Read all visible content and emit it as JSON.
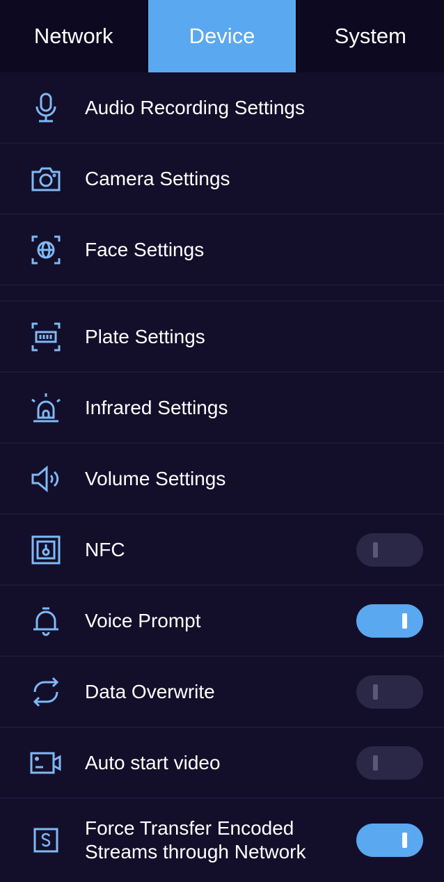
{
  "tabs": [
    {
      "label": "Network",
      "active": false
    },
    {
      "label": "Device",
      "active": true
    },
    {
      "label": "System",
      "active": false
    }
  ],
  "items": [
    {
      "label": "Audio Recording Settings",
      "icon": "microphone-icon"
    },
    {
      "label": "Camera Settings",
      "icon": "camera-icon"
    },
    {
      "label": "Face Settings",
      "icon": "face-scan-icon"
    },
    {
      "label": "Plate Settings",
      "icon": "license-plate-icon"
    },
    {
      "label": "Infrared Settings",
      "icon": "alarm-light-icon"
    },
    {
      "label": "Volume Settings",
      "icon": "speaker-icon"
    },
    {
      "label": "NFC",
      "icon": "nfc-icon",
      "toggle": false
    },
    {
      "label": "Voice Prompt",
      "icon": "bell-icon",
      "toggle": true
    },
    {
      "label": "Data Overwrite",
      "icon": "sync-arrows-icon",
      "toggle": false
    },
    {
      "label": "Auto start video",
      "icon": "video-camera-icon",
      "toggle": false
    },
    {
      "label": "Force Transfer Encoded Streams through Network",
      "icon": "s-box-icon",
      "toggle": true
    }
  ],
  "colors": {
    "background": "#130f2a",
    "accent": "#5aa8f0",
    "icon": "#7fb9f5",
    "toggle_off": "#2a2747"
  }
}
